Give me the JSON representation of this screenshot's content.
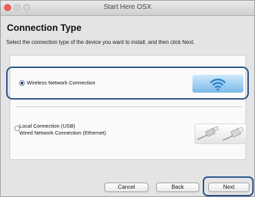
{
  "window": {
    "title": "Start Here OSX"
  },
  "page": {
    "heading": "Connection Type",
    "instructions": "Select the connection type of the device you want to install, and then click Next."
  },
  "options": [
    {
      "label_lines": [
        "Wireless Network Connection"
      ],
      "selected": true,
      "icon": "wifi-icon"
    },
    {
      "label_lines": [
        "Local Connection (USB)",
        "Wired Network Connection (Ethernet)"
      ],
      "selected": false,
      "icon": "usb-ethernet-cables-icon"
    }
  ],
  "buttons": {
    "cancel": "Cancel",
    "back": "Back",
    "next": "Next"
  },
  "colors": {
    "highlight": "#1f4f88",
    "wifi_icon": "#2d86c9",
    "close_button": "#fb5b56"
  }
}
